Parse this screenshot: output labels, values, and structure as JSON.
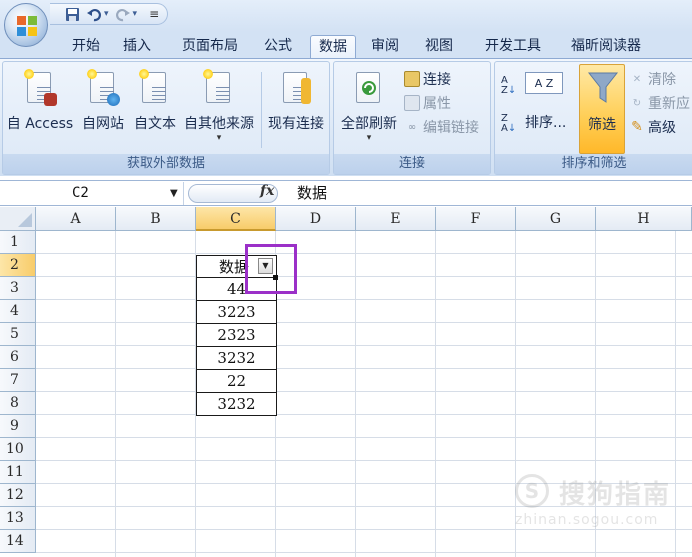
{
  "quick_access": {
    "save_icon": "save-icon",
    "undo_icon": "undo-icon",
    "redo_icon": "redo-icon",
    "customize_glyph": "≡"
  },
  "tabs": [
    "开始",
    "插入",
    "页面布局",
    "公式",
    "数据",
    "审阅",
    "视图",
    "开发工具",
    "福昕阅读器"
  ],
  "active_tab": "数据",
  "ribbon": {
    "get_external_data": {
      "label": "获取外部数据",
      "buttons": [
        "自 Access",
        "自网站",
        "自文本",
        "自其他来源",
        "现有连接"
      ]
    },
    "connections": {
      "label": "连接",
      "refresh_all": "全部刷新",
      "items": [
        "连接",
        "属性",
        "编辑链接"
      ]
    },
    "sort_filter": {
      "label": "排序和筛选",
      "sort_asc": "A Z",
      "sort": "排序...",
      "filter": "筛选",
      "items": [
        "清除",
        "重新应",
        "高级"
      ]
    }
  },
  "formula_bar": {
    "name_box": "C2",
    "fx": "fx",
    "content": "数据"
  },
  "columns": [
    "A",
    "B",
    "C",
    "D",
    "E",
    "F",
    "G",
    "H"
  ],
  "selected_column": "C",
  "rows": [
    "1",
    "2",
    "3",
    "4",
    "5",
    "6",
    "7",
    "8",
    "9",
    "10",
    "11",
    "12",
    "13",
    "14"
  ],
  "selected_row": "2",
  "data_cells": {
    "header": "数据",
    "values": [
      "44",
      "3223",
      "2323",
      "3232",
      "22",
      "3232"
    ]
  },
  "watermark": {
    "icon": "S",
    "text": "搜狗指南",
    "url": "zhinan.sogou.com"
  }
}
